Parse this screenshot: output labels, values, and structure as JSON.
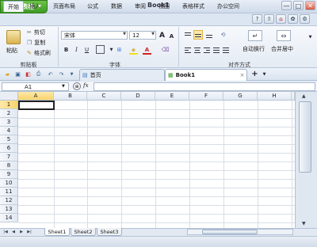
{
  "app": {
    "name": "WPS 表格",
    "doc_title": "Book1"
  },
  "window": {
    "min": "—",
    "max": "□",
    "close": "✕"
  },
  "menu": [
    "开始",
    "插入",
    "页面布局",
    "公式",
    "数据",
    "审阅",
    "视图",
    "表格样式",
    "办公空间"
  ],
  "ribbon": {
    "paste": "粘贴",
    "cut": "剪切",
    "copy": "复制",
    "format_painter": "格式刷",
    "clipboard_group": "剪贴板",
    "font_name": "宋体",
    "font_size": "12",
    "font_group": "字体",
    "align_group": "对齐方式",
    "wrap": "自动换行",
    "merge": "合并居中",
    "bold": "B",
    "italic": "I",
    "underline": "U",
    "grow": "A",
    "shrink": "A"
  },
  "doctabs": {
    "home": "首页",
    "book": "Book1"
  },
  "formula": {
    "namebox": "A1",
    "fx": "fx"
  },
  "columns": [
    "A",
    "B",
    "C",
    "D",
    "E",
    "F",
    "G",
    "H"
  ],
  "rows": [
    "1",
    "2",
    "3",
    "4",
    "5",
    "6",
    "7",
    "8",
    "9",
    "10",
    "11",
    "12",
    "13",
    "14"
  ],
  "active_cell": "A1",
  "sheets": [
    "Sheet1",
    "Sheet2",
    "Sheet3"
  ],
  "colors": {
    "accent_green": "#4aa82d",
    "selection": "#f8d36c"
  }
}
